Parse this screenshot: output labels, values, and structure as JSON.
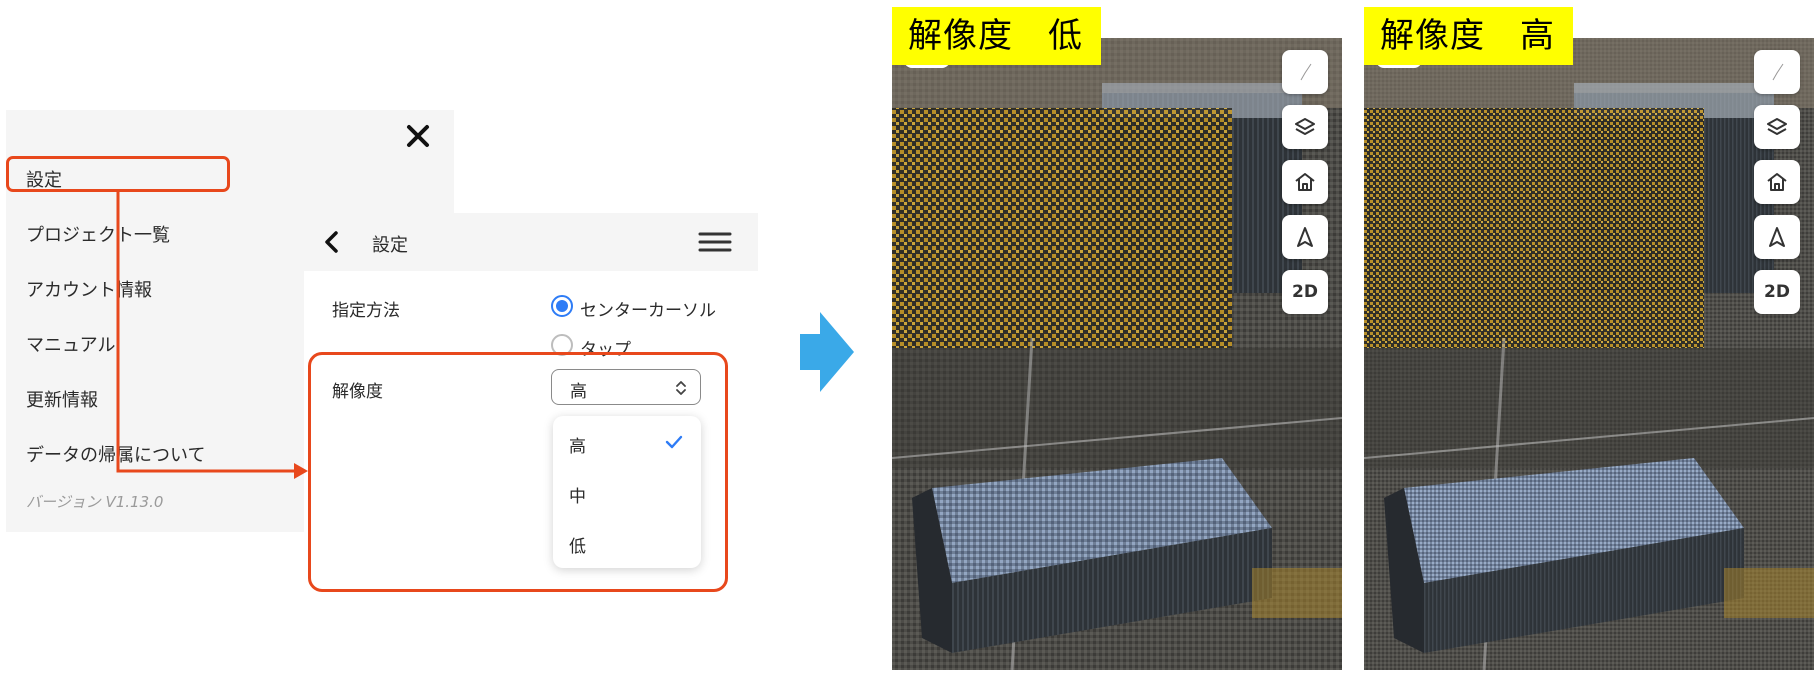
{
  "menu": {
    "close_icon": "close-icon",
    "items": [
      {
        "label": "設定"
      },
      {
        "label": "プロジェクト一覧"
      },
      {
        "label": "アカウント情報"
      },
      {
        "label": "マニュアル"
      },
      {
        "label": "更新情報"
      },
      {
        "label": "データの帰属について"
      }
    ],
    "version": "バージョン V1.13.0"
  },
  "settings": {
    "title": "設定",
    "method_label": "指定方法",
    "method_options": [
      "センターカーソル",
      "タップ"
    ],
    "method_selected": "センターカーソル",
    "resolution_label": "解像度",
    "resolution_value": "高",
    "resolution_options": [
      "高",
      "中",
      "低"
    ]
  },
  "views": [
    {
      "label": "解像度　低",
      "button_2d": "2D"
    },
    {
      "label": "解像度　高",
      "button_2d": "2D"
    }
  ],
  "colors": {
    "highlight": "#e8481c",
    "accent": "#2e7cf6",
    "arrow": "#3aa9e8",
    "label_bg": "#ffff00"
  }
}
